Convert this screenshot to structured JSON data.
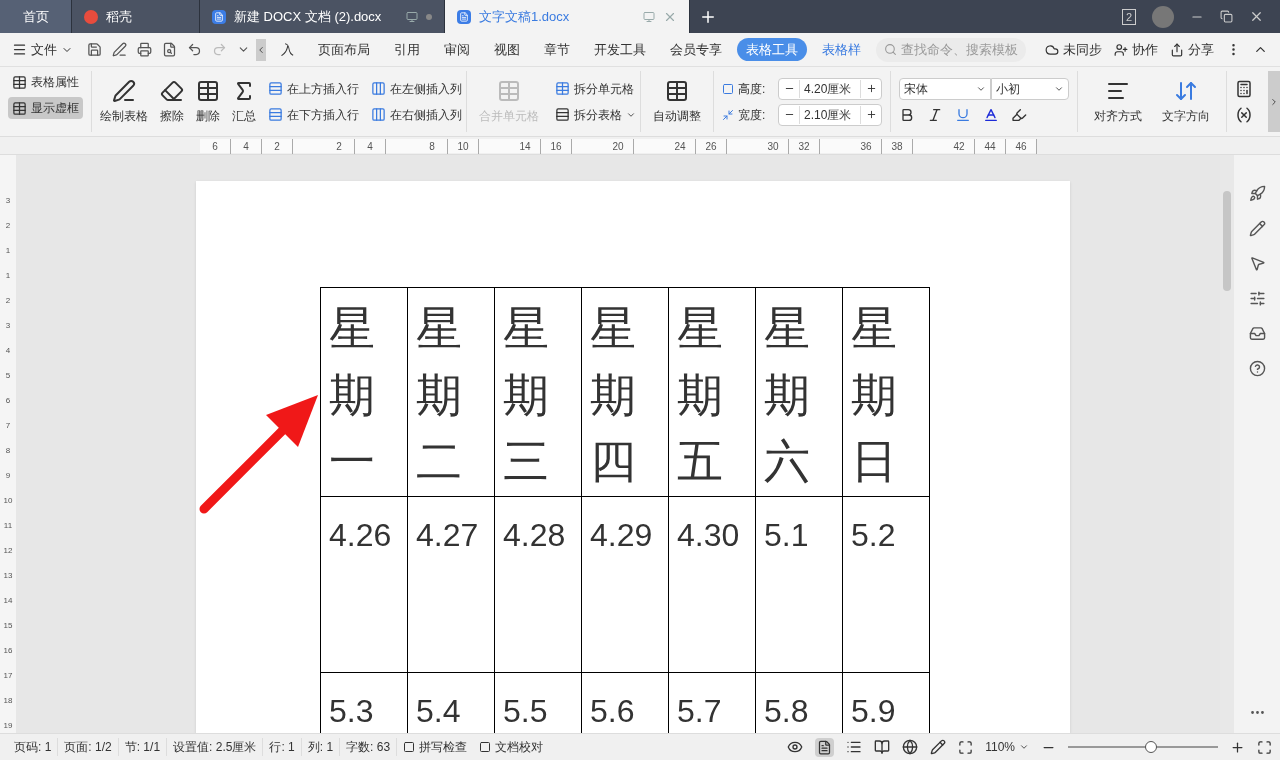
{
  "tabs": [
    {
      "label": "首页",
      "kind": "home",
      "selected": false
    },
    {
      "label": "稻壳",
      "kind": "app",
      "selected": false
    },
    {
      "label": "新建 DOCX 文档 (2).docx",
      "kind": "doc",
      "selected": false
    },
    {
      "label": "文字文稿1.docx",
      "kind": "doc",
      "selected": true
    }
  ],
  "window_badge": "2",
  "menu": {
    "file": "文件",
    "tabs": [
      {
        "label": "入",
        "selected": false
      },
      {
        "label": "页面布局",
        "selected": false
      },
      {
        "label": "引用",
        "selected": false
      },
      {
        "label": "审阅",
        "selected": false
      },
      {
        "label": "视图",
        "selected": false
      },
      {
        "label": "章节",
        "selected": false
      },
      {
        "label": "开发工具",
        "selected": false
      },
      {
        "label": "会员专享",
        "selected": false
      },
      {
        "label": "表格工具",
        "selected": true
      },
      {
        "label": "表格样",
        "selected": false
      }
    ],
    "search": {
      "placeholder": "查找命令、搜索模板"
    },
    "actions": [
      "未同步",
      "协作",
      "分享"
    ]
  },
  "ribbon": {
    "table_props": "表格属性",
    "show_gridlines": {
      "label": "显示虚框",
      "on": true
    },
    "big_buttons": [
      {
        "label": "绘制表格",
        "kind": "draw"
      },
      {
        "label": "擦除",
        "kind": "erase"
      },
      {
        "label": "删除",
        "kind": "delete"
      },
      {
        "label": "汇总",
        "kind": "sum"
      }
    ],
    "insert": [
      {
        "label": "在上方插入行",
        "kind": "row"
      },
      {
        "label": "在左侧插入列",
        "kind": "col"
      },
      {
        "label": "在下方插入行",
        "kind": "row"
      },
      {
        "label": "在右侧插入列",
        "kind": "col"
      }
    ],
    "merge": {
      "label": "合并单元格",
      "disabled": true
    },
    "split_cells": "拆分单元格",
    "split_table": "拆分表格",
    "autofit": "自动调整",
    "height": {
      "label": "高度:",
      "value": "4.20厘米"
    },
    "width": {
      "label": "宽度:",
      "value": "2.10厘米"
    },
    "font": "宋体",
    "font_size": "小初",
    "align": "对齐方式",
    "direction": "文字方向"
  },
  "ruler": [
    "6",
    "4",
    "2",
    "2",
    "4",
    "8",
    "10",
    "14",
    "16",
    "20",
    "24",
    "26",
    "30",
    "32",
    "36",
    "38",
    "42",
    "44",
    "46"
  ],
  "vruler": [
    "3",
    "2",
    "1",
    "1",
    "2",
    "3",
    "4",
    "5",
    "6",
    "7",
    "8",
    "9",
    "10",
    "11",
    "12",
    "13",
    "14",
    "15",
    "16",
    "17",
    "18",
    "19"
  ],
  "table": {
    "header": [
      "星期一",
      "星期二",
      "星期三",
      "星期四",
      "星期五",
      "星期六",
      "星期日"
    ],
    "rows": [
      [
        "4.26",
        "4.27",
        "4.28",
        "4.29",
        "4.30",
        "5.1",
        "5.2"
      ],
      [
        "5.3",
        "5.4",
        "5.5",
        "5.6",
        "5.7",
        "5.8",
        "5.9"
      ]
    ]
  },
  "status": {
    "items": [
      "页码: 1",
      "页面: 1/2",
      "节: 1/1",
      "设置值: 2.5厘米",
      "行: 1",
      "列: 1",
      "字数: 63"
    ],
    "checks": [
      "拼写检查",
      "文档校对"
    ],
    "zoom": "110%",
    "zoom_slider": {
      "level": 0.55
    }
  }
}
